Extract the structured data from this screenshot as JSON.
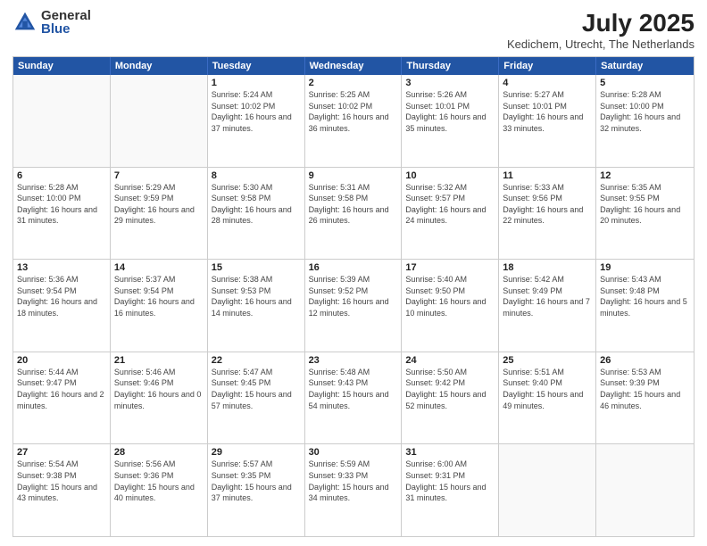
{
  "header": {
    "logo": {
      "general": "General",
      "blue": "Blue"
    },
    "title": "July 2025",
    "location": "Kedichem, Utrecht, The Netherlands"
  },
  "weekdays": [
    "Sunday",
    "Monday",
    "Tuesday",
    "Wednesday",
    "Thursday",
    "Friday",
    "Saturday"
  ],
  "weeks": [
    [
      {
        "day": "",
        "sunrise": "",
        "sunset": "",
        "daylight": ""
      },
      {
        "day": "",
        "sunrise": "",
        "sunset": "",
        "daylight": ""
      },
      {
        "day": "1",
        "sunrise": "Sunrise: 5:24 AM",
        "sunset": "Sunset: 10:02 PM",
        "daylight": "Daylight: 16 hours and 37 minutes."
      },
      {
        "day": "2",
        "sunrise": "Sunrise: 5:25 AM",
        "sunset": "Sunset: 10:02 PM",
        "daylight": "Daylight: 16 hours and 36 minutes."
      },
      {
        "day": "3",
        "sunrise": "Sunrise: 5:26 AM",
        "sunset": "Sunset: 10:01 PM",
        "daylight": "Daylight: 16 hours and 35 minutes."
      },
      {
        "day": "4",
        "sunrise": "Sunrise: 5:27 AM",
        "sunset": "Sunset: 10:01 PM",
        "daylight": "Daylight: 16 hours and 33 minutes."
      },
      {
        "day": "5",
        "sunrise": "Sunrise: 5:28 AM",
        "sunset": "Sunset: 10:00 PM",
        "daylight": "Daylight: 16 hours and 32 minutes."
      }
    ],
    [
      {
        "day": "6",
        "sunrise": "Sunrise: 5:28 AM",
        "sunset": "Sunset: 10:00 PM",
        "daylight": "Daylight: 16 hours and 31 minutes."
      },
      {
        "day": "7",
        "sunrise": "Sunrise: 5:29 AM",
        "sunset": "Sunset: 9:59 PM",
        "daylight": "Daylight: 16 hours and 29 minutes."
      },
      {
        "day": "8",
        "sunrise": "Sunrise: 5:30 AM",
        "sunset": "Sunset: 9:58 PM",
        "daylight": "Daylight: 16 hours and 28 minutes."
      },
      {
        "day": "9",
        "sunrise": "Sunrise: 5:31 AM",
        "sunset": "Sunset: 9:58 PM",
        "daylight": "Daylight: 16 hours and 26 minutes."
      },
      {
        "day": "10",
        "sunrise": "Sunrise: 5:32 AM",
        "sunset": "Sunset: 9:57 PM",
        "daylight": "Daylight: 16 hours and 24 minutes."
      },
      {
        "day": "11",
        "sunrise": "Sunrise: 5:33 AM",
        "sunset": "Sunset: 9:56 PM",
        "daylight": "Daylight: 16 hours and 22 minutes."
      },
      {
        "day": "12",
        "sunrise": "Sunrise: 5:35 AM",
        "sunset": "Sunset: 9:55 PM",
        "daylight": "Daylight: 16 hours and 20 minutes."
      }
    ],
    [
      {
        "day": "13",
        "sunrise": "Sunrise: 5:36 AM",
        "sunset": "Sunset: 9:54 PM",
        "daylight": "Daylight: 16 hours and 18 minutes."
      },
      {
        "day": "14",
        "sunrise": "Sunrise: 5:37 AM",
        "sunset": "Sunset: 9:54 PM",
        "daylight": "Daylight: 16 hours and 16 minutes."
      },
      {
        "day": "15",
        "sunrise": "Sunrise: 5:38 AM",
        "sunset": "Sunset: 9:53 PM",
        "daylight": "Daylight: 16 hours and 14 minutes."
      },
      {
        "day": "16",
        "sunrise": "Sunrise: 5:39 AM",
        "sunset": "Sunset: 9:52 PM",
        "daylight": "Daylight: 16 hours and 12 minutes."
      },
      {
        "day": "17",
        "sunrise": "Sunrise: 5:40 AM",
        "sunset": "Sunset: 9:50 PM",
        "daylight": "Daylight: 16 hours and 10 minutes."
      },
      {
        "day": "18",
        "sunrise": "Sunrise: 5:42 AM",
        "sunset": "Sunset: 9:49 PM",
        "daylight": "Daylight: 16 hours and 7 minutes."
      },
      {
        "day": "19",
        "sunrise": "Sunrise: 5:43 AM",
        "sunset": "Sunset: 9:48 PM",
        "daylight": "Daylight: 16 hours and 5 minutes."
      }
    ],
    [
      {
        "day": "20",
        "sunrise": "Sunrise: 5:44 AM",
        "sunset": "Sunset: 9:47 PM",
        "daylight": "Daylight: 16 hours and 2 minutes."
      },
      {
        "day": "21",
        "sunrise": "Sunrise: 5:46 AM",
        "sunset": "Sunset: 9:46 PM",
        "daylight": "Daylight: 16 hours and 0 minutes."
      },
      {
        "day": "22",
        "sunrise": "Sunrise: 5:47 AM",
        "sunset": "Sunset: 9:45 PM",
        "daylight": "Daylight: 15 hours and 57 minutes."
      },
      {
        "day": "23",
        "sunrise": "Sunrise: 5:48 AM",
        "sunset": "Sunset: 9:43 PM",
        "daylight": "Daylight: 15 hours and 54 minutes."
      },
      {
        "day": "24",
        "sunrise": "Sunrise: 5:50 AM",
        "sunset": "Sunset: 9:42 PM",
        "daylight": "Daylight: 15 hours and 52 minutes."
      },
      {
        "day": "25",
        "sunrise": "Sunrise: 5:51 AM",
        "sunset": "Sunset: 9:40 PM",
        "daylight": "Daylight: 15 hours and 49 minutes."
      },
      {
        "day": "26",
        "sunrise": "Sunrise: 5:53 AM",
        "sunset": "Sunset: 9:39 PM",
        "daylight": "Daylight: 15 hours and 46 minutes."
      }
    ],
    [
      {
        "day": "27",
        "sunrise": "Sunrise: 5:54 AM",
        "sunset": "Sunset: 9:38 PM",
        "daylight": "Daylight: 15 hours and 43 minutes."
      },
      {
        "day": "28",
        "sunrise": "Sunrise: 5:56 AM",
        "sunset": "Sunset: 9:36 PM",
        "daylight": "Daylight: 15 hours and 40 minutes."
      },
      {
        "day": "29",
        "sunrise": "Sunrise: 5:57 AM",
        "sunset": "Sunset: 9:35 PM",
        "daylight": "Daylight: 15 hours and 37 minutes."
      },
      {
        "day": "30",
        "sunrise": "Sunrise: 5:59 AM",
        "sunset": "Sunset: 9:33 PM",
        "daylight": "Daylight: 15 hours and 34 minutes."
      },
      {
        "day": "31",
        "sunrise": "Sunrise: 6:00 AM",
        "sunset": "Sunset: 9:31 PM",
        "daylight": "Daylight: 15 hours and 31 minutes."
      },
      {
        "day": "",
        "sunrise": "",
        "sunset": "",
        "daylight": ""
      },
      {
        "day": "",
        "sunrise": "",
        "sunset": "",
        "daylight": ""
      }
    ]
  ]
}
